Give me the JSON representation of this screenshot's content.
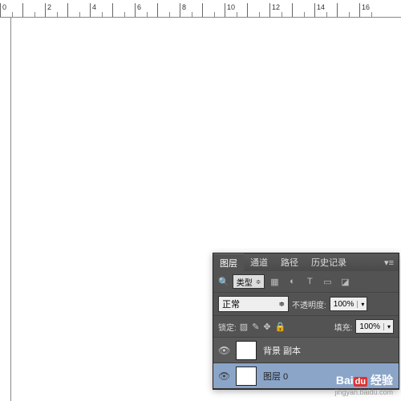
{
  "ruler": [
    "0",
    "",
    "2",
    "",
    "4",
    "",
    "6",
    "",
    "8",
    "",
    "10",
    "",
    "12",
    "",
    "14",
    "",
    "16"
  ],
  "panel": {
    "tabs": [
      "图层",
      "通道",
      "路径",
      "历史记录"
    ],
    "filter_label": "类型",
    "blend_mode": "正常",
    "opacity_label": "不透明度:",
    "opacity_value": "100%",
    "lock_label": "锁定:",
    "fill_label": "填充:",
    "fill_value": "100%"
  },
  "layers": [
    {
      "name": "背景 副本",
      "selected": false
    },
    {
      "name": "图层 0",
      "selected": true
    }
  ],
  "watermark": {
    "brand": "Bai",
    "brand2": "du",
    "suffix": "经验",
    "url": "jingyan.baidu.com"
  }
}
